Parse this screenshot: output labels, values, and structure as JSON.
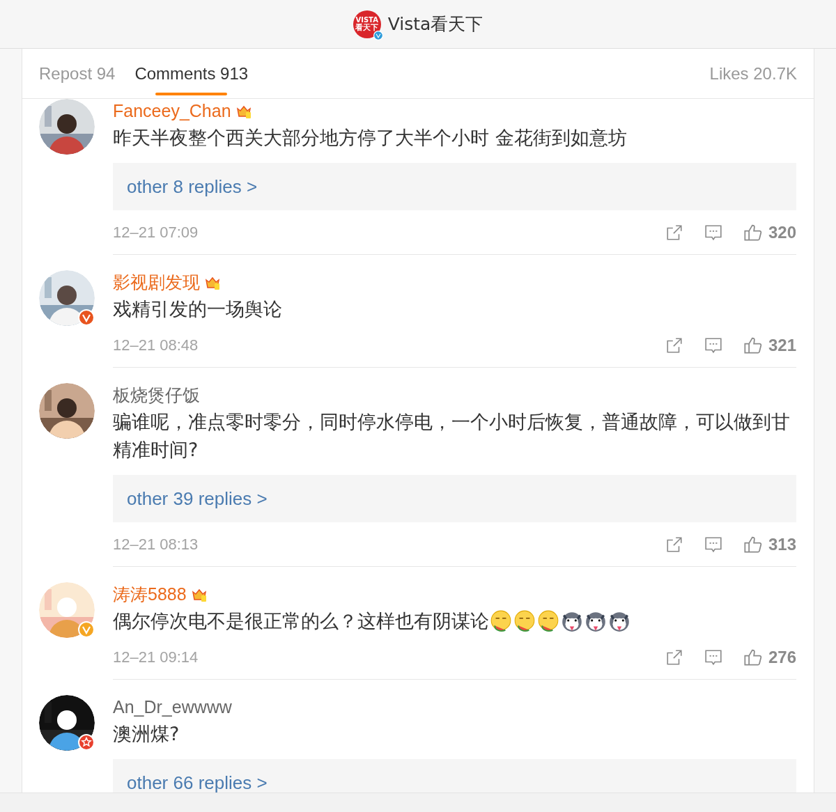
{
  "header": {
    "logo_text": "VISTA",
    "logo_sub": "看天下",
    "title": "Vista看天下"
  },
  "tabs": [
    {
      "label": "Repost 94",
      "selected": false
    },
    {
      "label": "Comments 913",
      "selected": true
    }
  ],
  "likes": "Likes 20.7K",
  "comments": [
    {
      "name": "Fanceey_Chan",
      "vip": true,
      "text": "昨天半夜整个西关大部分地方停了大半个小时 金花街到如意坊",
      "replies": "other 8 replies >",
      "time": "12–21 07:09",
      "like_count": "320"
    },
    {
      "name": "影视剧发现",
      "vip": true,
      "avatar_badge": {
        "kind": "v",
        "color": "#e8541e"
      },
      "text": "戏精引发的一场舆论",
      "time": "12–21 08:48",
      "like_count": "321"
    },
    {
      "name": "板烧煲仔饭",
      "vip": false,
      "text": "骗谁呢，准点零时零分，同时停水停电，一个小时后恢复，普通故障，可以做到甘精准时间?",
      "replies": "other 39 replies >",
      "time": "12–21 08:13",
      "like_count": "313"
    },
    {
      "name": "涛涛5888",
      "vip": true,
      "avatar_badge": {
        "kind": "v",
        "color": "#f5a623"
      },
      "text": "偶尔停次电不是很正常的么？这样也有阴谋论",
      "emojis": [
        {
          "kind": "melon"
        },
        {
          "kind": "melon"
        },
        {
          "kind": "melon"
        },
        {
          "kind": "husky"
        },
        {
          "kind": "husky"
        },
        {
          "kind": "husky"
        }
      ],
      "time": "12–21 09:14",
      "like_count": "276"
    },
    {
      "name": "An_Dr_ewwww",
      "vip": false,
      "avatar_badge": {
        "kind": "star",
        "color": "#e8402e"
      },
      "text": "澳洲煤?",
      "replies": "other 66 replies >"
    }
  ]
}
